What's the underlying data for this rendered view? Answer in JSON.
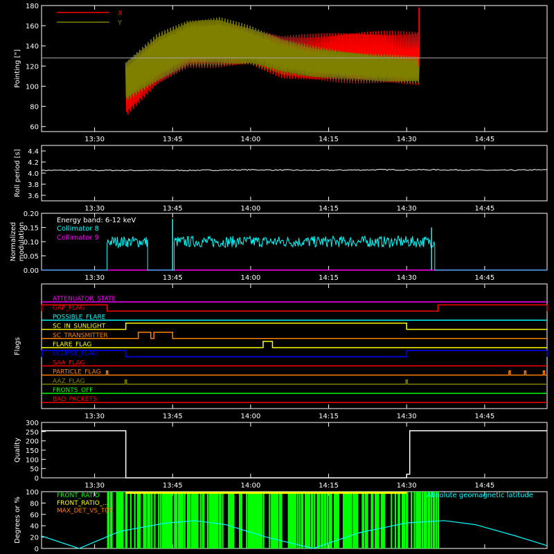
{
  "time_axis": {
    "ticks": [
      "13:30",
      "13:45",
      "14:00",
      "14:15",
      "14:30",
      "14:45"
    ],
    "tick_hours": [
      13.5,
      13.75,
      14.0,
      14.25,
      14.5,
      14.75
    ],
    "range": [
      13.33,
      14.95
    ]
  },
  "colors": {
    "background": "#000000",
    "axes": "#ffffff",
    "red": "#ff0000",
    "olive": "#808000",
    "cyan": "#00ffff",
    "magenta": "#ff00ff",
    "white": "#ffffff",
    "green": "#00ff00",
    "yellow": "#ffff00",
    "orange": "#ff8000",
    "blue": "#0000ff"
  },
  "chart_data": [
    {
      "id": "pointing",
      "type": "line",
      "title": "",
      "ylabel": "Pointing [\"]",
      "ylim": [
        55,
        180
      ],
      "yticks": [
        60,
        80,
        100,
        120,
        140,
        160,
        180
      ],
      "legend": {
        "placement": "top-left",
        "entries": [
          "X",
          "Y"
        ]
      },
      "reference_line": 128,
      "x_range": [
        13.6,
        14.54
      ],
      "series": [
        {
          "name": "X",
          "color": "#ff0000",
          "upper_env": {
            "x": [
              13.6,
              13.7,
              13.8,
              13.9,
              14.0,
              14.1,
              14.2,
              14.3,
              14.4,
              14.54
            ],
            "y": [
              120,
              148,
              163,
              166,
              158,
              151,
              152,
              154,
              155,
              155
            ]
          },
          "lower_env": {
            "x": [
              13.6,
              13.7,
              13.8,
              13.9,
              14.0,
              14.1,
              14.2,
              14.3,
              14.4,
              14.54
            ],
            "y": [
              70,
              100,
              118,
              118,
              121,
              108,
              105,
              103,
              102,
              101
            ]
          }
        },
        {
          "name": "Y",
          "color": "#808000",
          "upper_env": {
            "x": [
              13.6,
              13.7,
              13.8,
              13.9,
              14.0,
              14.1,
              14.2,
              14.3,
              14.4,
              14.54
            ],
            "y": [
              125,
              152,
              166,
              169,
              160,
              148,
              140,
              135,
              132,
              130
            ]
          },
          "lower_env": {
            "x": [
              13.6,
              13.7,
              13.8,
              13.9,
              14.0,
              14.1,
              14.2,
              14.3,
              14.4,
              14.54
            ],
            "y": [
              85,
              103,
              120,
              120,
              121,
              112,
              108,
              106,
              104,
              103
            ]
          }
        }
      ]
    },
    {
      "id": "roll_period",
      "type": "line",
      "ylabel": "Roll period [s]",
      "ylim": [
        3.5,
        4.5
      ],
      "yticks": [
        3.6,
        3.8,
        4.0,
        4.2,
        4.4
      ],
      "series": [
        {
          "name": "",
          "color": "#ffffff",
          "x": [
            13.35,
            13.6,
            13.8,
            14.0,
            14.2,
            14.4,
            14.6,
            14.8,
            14.95
          ],
          "y": [
            4.05,
            4.05,
            4.05,
            4.06,
            4.05,
            4.06,
            4.06,
            4.05,
            4.06
          ]
        }
      ]
    },
    {
      "id": "modulation",
      "type": "line",
      "ylabel": "Normalized\nmodulation",
      "ylim": [
        0,
        0.2
      ],
      "yticks": [
        0.0,
        0.05,
        0.1,
        0.15,
        0.2
      ],
      "legend_title": "Energy band: 6-12 keV",
      "legend": {
        "placement": "top-left",
        "entries": [
          "Collimator 8",
          "Collimator 9"
        ]
      },
      "series": [
        {
          "name": "Collimator 8",
          "color": "#00ffff",
          "segments": [
            {
              "start": 13.54,
              "end": 13.67,
              "mean": 0.1,
              "spread": 0.02,
              "peak": 0.12
            },
            {
              "start": 13.755,
              "end": 14.59,
              "mean": 0.1,
              "spread": 0.02,
              "peak": 0.15
            }
          ],
          "spikes": [
            {
              "x": 13.75,
              "y": 0.18
            },
            {
              "x": 14.58,
              "y": 0.15
            }
          ]
        },
        {
          "name": "Collimator 9",
          "color": "#ff00ff",
          "x": [
            13.33,
            14.95
          ],
          "y": [
            0.0,
            0.0
          ]
        }
      ]
    },
    {
      "id": "flags",
      "type": "line",
      "ylabel": "Flags",
      "flags": [
        {
          "name": "ATTENUATOR_STATE",
          "color": "#ff00ff",
          "high": []
        },
        {
          "name": "GAP_FLAG",
          "color": "#ff0000",
          "high": [
            [
              13.33,
              13.54
            ],
            [
              14.6,
              14.95
            ]
          ]
        },
        {
          "name": "POSSIBLE_FLARE",
          "color": "#00ffff",
          "high": []
        },
        {
          "name": "SC_IN_SUNLIGHT",
          "color": "#ffff00",
          "high": [
            [
              13.6,
              14.5
            ]
          ]
        },
        {
          "name": "SC_TRANSMITTER",
          "color": "#ff8000",
          "high": [
            [
              13.64,
              13.68
            ],
            [
              13.69,
              13.75
            ]
          ]
        },
        {
          "name": "FLARE_FLAG",
          "color": "#ffff00",
          "high": [
            [
              14.04,
              14.07
            ]
          ]
        },
        {
          "name": "ECLIPSE_FLAG",
          "color": "#0000ff",
          "high": [
            [
              13.33,
              13.6
            ],
            [
              14.5,
              14.95
            ]
          ]
        },
        {
          "name": "SAA_FLAG",
          "color": "#ff0000",
          "high": []
        },
        {
          "name": "PARTICLE_FLAG",
          "color": "#ff8000",
          "pulses": [
            13.54,
            14.83,
            14.88,
            14.94
          ]
        },
        {
          "name": "AAZ_FLAG",
          "color": "#808000",
          "pulses": [
            13.6,
            14.5
          ]
        },
        {
          "name": "FRONTS_OFF",
          "color": "#00ff00",
          "high": []
        },
        {
          "name": "BAD_PACKETS",
          "color": "#ff0000",
          "high": []
        }
      ]
    },
    {
      "id": "quality",
      "type": "line",
      "ylabel": "Quality",
      "ylim": [
        0,
        300
      ],
      "yticks": [
        0,
        50,
        100,
        150,
        200,
        250,
        300
      ],
      "series": [
        {
          "name": "",
          "color": "#ffffff",
          "x": [
            13.33,
            13.6,
            13.6,
            14.5,
            14.5,
            14.51,
            14.51,
            14.95
          ],
          "y": [
            255,
            255,
            0,
            0,
            20,
            20,
            255,
            255
          ]
        }
      ]
    },
    {
      "id": "degrees",
      "type": "line",
      "ylabel": "Degrees or %",
      "ylim": [
        0,
        100
      ],
      "yticks": [
        0,
        20,
        40,
        60,
        80,
        100
      ],
      "legend": {
        "placement": "top-left",
        "entries": [
          "FRONT_RATIO",
          "FRONT_RATIO_...",
          "MAX_DET_VS_TOT"
        ]
      },
      "legend_right": "Absolute geomagnetic latitude",
      "series": [
        {
          "name": "Absolute geomagnetic latitude",
          "color": "#00ffff",
          "x": [
            13.33,
            13.45,
            13.58,
            13.72,
            13.82,
            13.92,
            14.05,
            14.2,
            14.35,
            14.5,
            14.62,
            14.72,
            14.85,
            14.95
          ],
          "y": [
            22,
            0,
            30,
            44,
            49,
            42,
            20,
            0,
            28,
            45,
            49,
            42,
            22,
            5
          ]
        },
        {
          "name": "FRONT_RATIO",
          "color": "#00ff00",
          "start": 13.54,
          "end": 14.6
        },
        {
          "name": "FRONT_RATIO_...",
          "color": "#ffff00",
          "start": 13.6,
          "end": 14.5
        },
        {
          "name": "MAX_DET_VS_TOT",
          "color": "#ff8000"
        }
      ]
    }
  ]
}
